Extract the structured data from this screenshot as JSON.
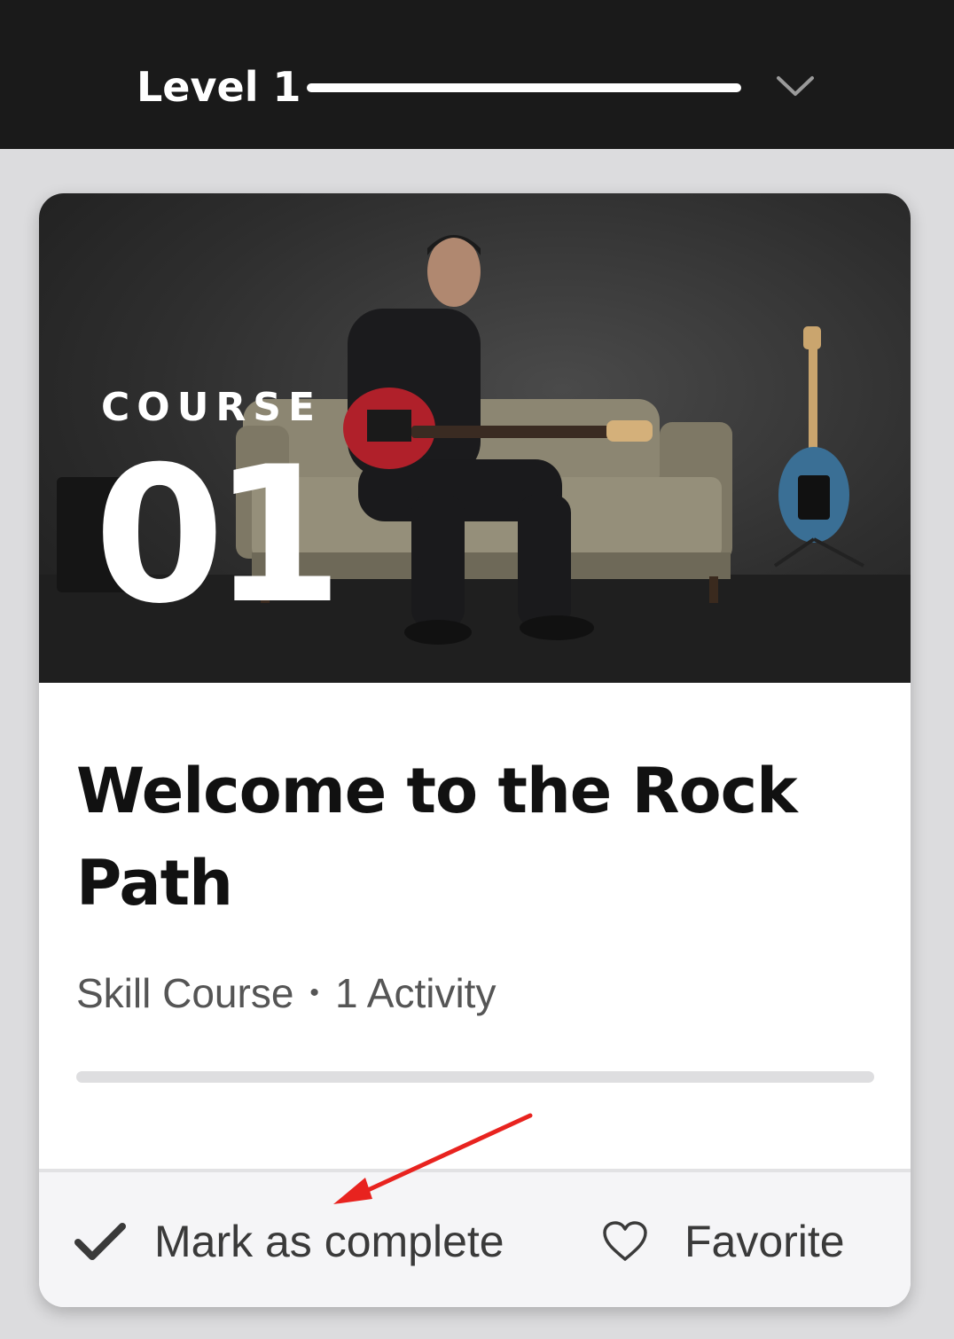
{
  "header": {
    "level_title": "Level 1",
    "level_progress": 1.0,
    "chevron_icon": "chevron-down-icon"
  },
  "card": {
    "course_label": "COURSE",
    "course_number": "01",
    "title": "Welcome to the Rock Path",
    "meta": {
      "type": "Skill Course",
      "separator": "•",
      "activities": "1 Activity"
    },
    "progress": 0.0,
    "actions": {
      "mark_complete_label": "Mark as complete",
      "mark_complete_icon": "check-icon",
      "favorite_label": "Favorite",
      "favorite_icon": "heart-outline-icon"
    }
  },
  "colors": {
    "header_bg": "#1a1a1a",
    "page_bg": "#dcdcde",
    "annotation_arrow": "#e8231f"
  }
}
